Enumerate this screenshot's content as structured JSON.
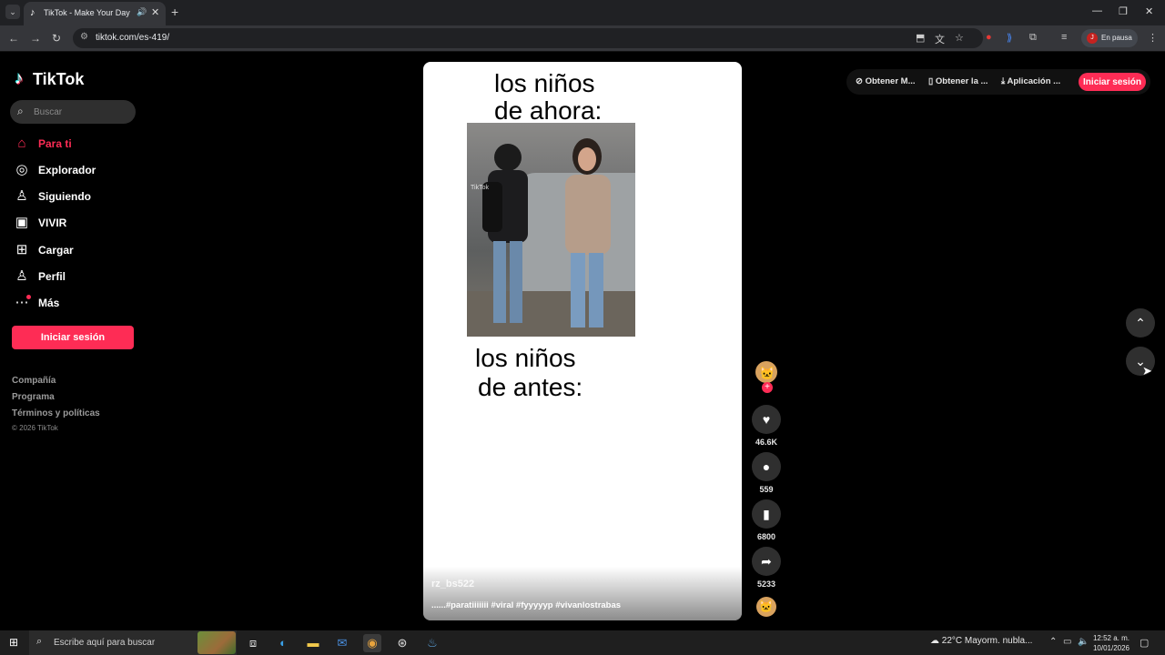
{
  "browser": {
    "tab_title": "TikTok - Make Your Day",
    "url": "tiktok.com/es-419/",
    "profile_initial": "J",
    "profile_status": "En pausa"
  },
  "sidebar": {
    "logo": "TikTok",
    "search_placeholder": "Buscar",
    "items": [
      {
        "label": "Para ti",
        "icon": "home-icon",
        "active": true
      },
      {
        "label": "Explorador",
        "icon": "compass-icon"
      },
      {
        "label": "Siguiendo",
        "icon": "following-icon"
      },
      {
        "label": "VIVIR",
        "icon": "live-icon"
      },
      {
        "label": "Cargar",
        "icon": "upload-icon"
      },
      {
        "label": "Perfil",
        "icon": "profile-icon"
      },
      {
        "label": "Más",
        "icon": "more-icon"
      }
    ],
    "login": "Iniciar sesión",
    "footer": [
      "Compañía",
      "Programa",
      "Términos y políticas"
    ],
    "copyright": "© 2026 TikTok"
  },
  "top": {
    "get_m": "Obtener M...",
    "get_la": "Obtener la ...",
    "app": "Aplicación ...",
    "login": "Iniciar sesión"
  },
  "video": {
    "text_top_1": "los niños",
    "text_top_2": "de ahora:",
    "text_bottom_1": "los niños",
    "text_bottom_2": "de antes:",
    "username": "rz_bs522",
    "caption": "......#paratiiiiiii #viral #fyyyyyp #vivanlostrabas",
    "photo_watermark": "TikTok"
  },
  "actions": {
    "likes": "46.6K",
    "comments": "559",
    "saves": "6800",
    "shares": "5233"
  },
  "colors": {
    "accent": "#fe2c55",
    "background": "#000000",
    "surface": "#2f2f2f"
  },
  "taskbar": {
    "search_placeholder": "Escribe aquí para buscar",
    "weather": "22°C  Mayorm. nubla...",
    "time": "12:52 a. m.",
    "date": "10/01/2026"
  }
}
